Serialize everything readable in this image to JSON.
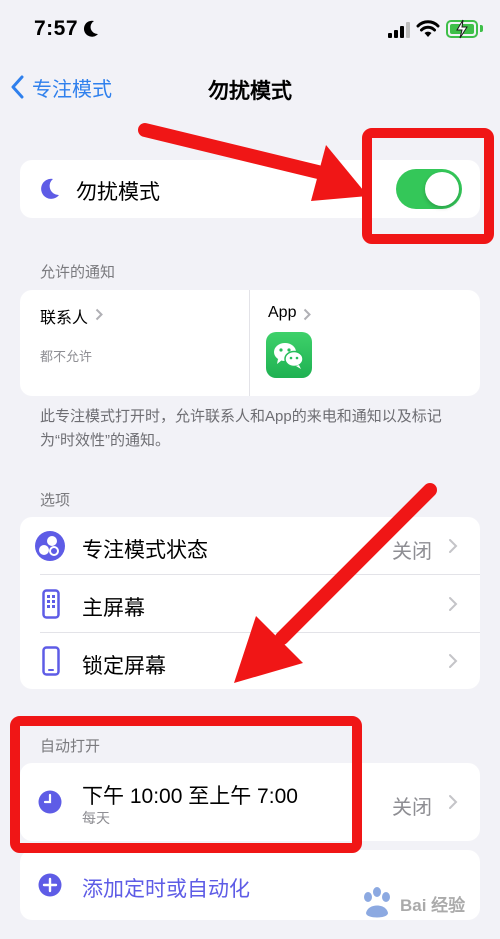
{
  "status_bar": {
    "time": "7:57"
  },
  "nav": {
    "back_label": "专注模式",
    "title": "勿扰模式"
  },
  "focus_toggle": {
    "label": "勿扰模式",
    "on": true
  },
  "allowed_notifications": {
    "header": "允许的通知",
    "people": {
      "label": "联系人",
      "subtitle": "都不允许"
    },
    "apps": {
      "label": "App",
      "app_icon": "wechat-icon"
    },
    "footnote": "此专注模式打开时，允许联系人和App的来电和通知以及标记为“时效性”的通知。"
  },
  "options": {
    "header": "选项",
    "items": [
      {
        "label": "专注模式状态",
        "value": "关闭",
        "icon": "focus-status-icon"
      },
      {
        "label": "主屏幕",
        "value": "",
        "icon": "home-screen-icon"
      },
      {
        "label": "锁定屏幕",
        "value": "",
        "icon": "lock-screen-icon"
      }
    ]
  },
  "auto_on": {
    "header": "自动打开",
    "schedule": {
      "time": "下午 10:00 至上午 7:00",
      "repeat": "每天",
      "value": "关闭"
    },
    "add_label": "添加定时或自动化"
  },
  "watermark": {
    "text": "Bai 经验"
  },
  "colors": {
    "accent": "#2f80ed",
    "purple": "#5e5ce6",
    "toggle_on": "#34c759",
    "annotation_red": "#f01616"
  }
}
